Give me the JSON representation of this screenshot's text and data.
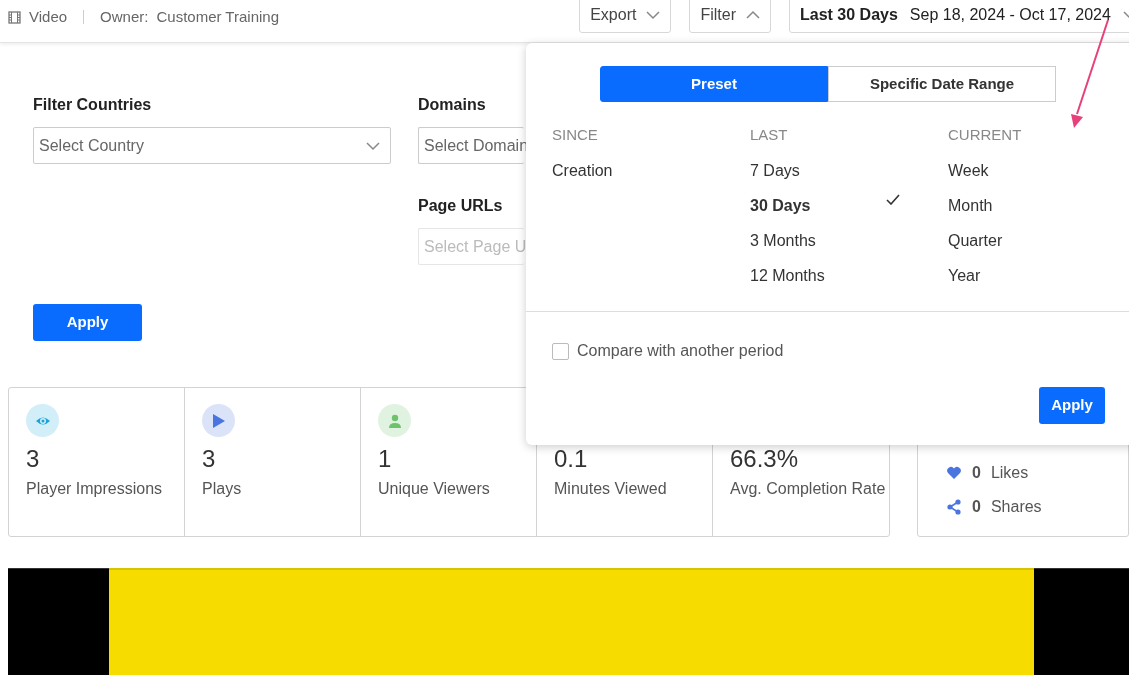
{
  "header": {
    "type_label": "Video",
    "owner_label": "Owner:",
    "owner": "Customer Training"
  },
  "toolbar": {
    "buttons": [
      {
        "label": "Export",
        "expanded": false
      },
      {
        "label": "Filter",
        "expanded": true
      }
    ],
    "date_button": {
      "preset": "Last 30 Days",
      "range": "Sep 18, 2024 - Oct 17, 2024"
    }
  },
  "filters": [
    {
      "label": "Filter Countries",
      "placeholder": "Select Country",
      "disabled": false
    },
    {
      "label": "Domains",
      "placeholder": "Select Domain",
      "disabled": false
    },
    {
      "label": "Page URLs",
      "placeholder": "Select Page U",
      "disabled": true
    }
  ],
  "filter_apply": "Apply",
  "date_picker": {
    "modes": [
      {
        "label": "Preset",
        "selected": true
      },
      {
        "label": "Specific Date Range",
        "selected": false
      }
    ],
    "columns": [
      {
        "heading": "SINCE",
        "options": [
          {
            "label": "Creation",
            "selected": false
          }
        ]
      },
      {
        "heading": "LAST",
        "options": [
          {
            "label": "7 Days",
            "selected": false
          },
          {
            "label": "30 Days",
            "selected": true
          },
          {
            "label": "3 Months",
            "selected": false
          },
          {
            "label": "12 Months",
            "selected": false
          }
        ]
      },
      {
        "heading": "CURRENT",
        "options": [
          {
            "label": "Week",
            "selected": false
          },
          {
            "label": "Month",
            "selected": false
          },
          {
            "label": "Quarter",
            "selected": false
          },
          {
            "label": "Year",
            "selected": false
          }
        ]
      }
    ],
    "compare": {
      "label": "Compare with another period",
      "checked": false
    },
    "apply": "Apply"
  },
  "stats": [
    {
      "kind": "impressions",
      "value": "3",
      "label": "Player Impressions"
    },
    {
      "kind": "plays",
      "value": "3",
      "label": "Plays"
    },
    {
      "kind": "viewers",
      "value": "1",
      "label": "Unique Viewers"
    },
    {
      "kind": "hidden",
      "value": "0.1",
      "label": "Minutes Viewed"
    },
    {
      "kind": "hidden",
      "value": "66.3%",
      "label": "Avg. Completion Rate"
    }
  ],
  "engagement": [
    {
      "kind": "likes",
      "value": "0",
      "label": "Likes"
    },
    {
      "kind": "shares",
      "value": "0",
      "label": "Shares"
    }
  ]
}
